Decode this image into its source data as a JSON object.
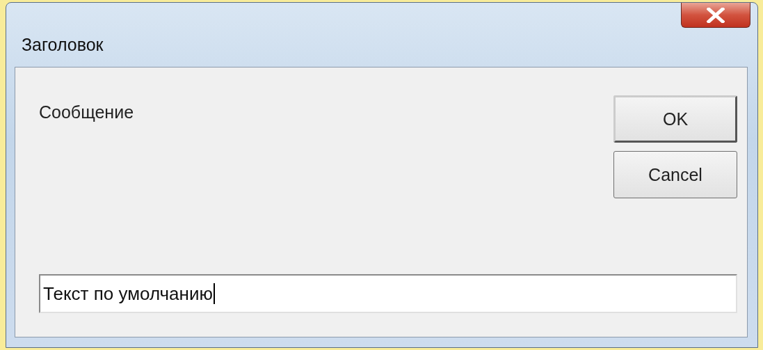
{
  "window": {
    "title": "Заголовок"
  },
  "message": "Сообщение",
  "buttons": [
    {
      "label": "OK",
      "default": true
    },
    {
      "label": "Cancel",
      "default": false
    }
  ],
  "input": {
    "value": "Текст по умолчанию",
    "focused": true
  }
}
